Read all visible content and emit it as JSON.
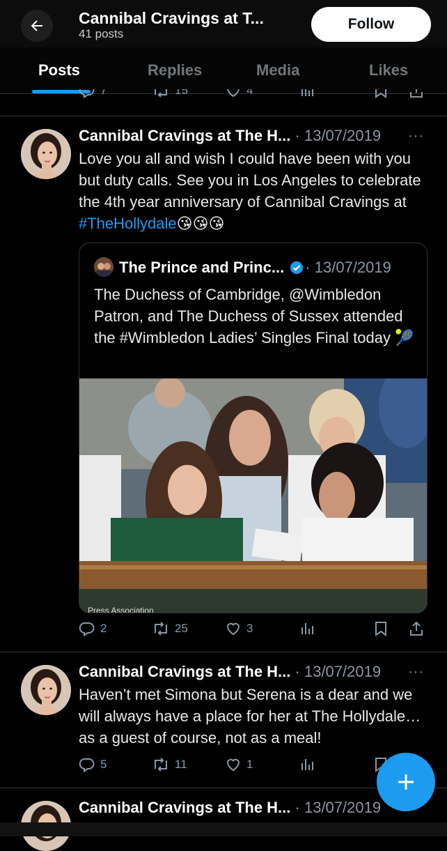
{
  "header": {
    "title": "Cannibal Cravings at T...",
    "subtitle": "41 posts",
    "follow_label": "Follow",
    "back_icon": "arrow-left-icon"
  },
  "tabs": [
    {
      "label": "Posts",
      "active": true
    },
    {
      "label": "Replies",
      "active": false
    },
    {
      "label": "Media",
      "active": false
    },
    {
      "label": "Likes",
      "active": false
    }
  ],
  "partial_post": {
    "replies": "7",
    "reposts": "15",
    "likes": "4"
  },
  "posts": [
    {
      "author": "Cannibal Cravings at The H...",
      "date": "13/07/2019",
      "text": "Love you all and wish I could have been with you but duty calls. See you in Los Angeles to celebrate the 4th year anniversary of Cannibal Cravings at ",
      "hashtag": "#TheHollydale",
      "emojis": "😘😘😘",
      "quote": {
        "author": "The Prince and Princ...",
        "date": "13/07/2019",
        "text": "The Duchess of Cambridge, @Wimbledon Patron, and The Duchess of Sussex attended the #Wimbledon Ladies’ Singles Final today 🎾",
        "photo_caption": "Press Association"
      },
      "replies": "2",
      "reposts": "25",
      "likes": "3"
    },
    {
      "author": "Cannibal Cravings at The H...",
      "date": "13/07/2019",
      "text": "Haven’t met Simona but Serena is a dear and we will always have a place for her at The Hollydale… as a guest of course, not as a meal!",
      "replies": "5",
      "reposts": "11",
      "likes": "1"
    },
    {
      "author": "Cannibal Cravings at The H...",
      "date": "13/07/2019"
    }
  ],
  "fab_icon": "plus-icon",
  "colors": {
    "accent": "#1d9bf0",
    "background": "#000000",
    "muted": "#71767b"
  }
}
